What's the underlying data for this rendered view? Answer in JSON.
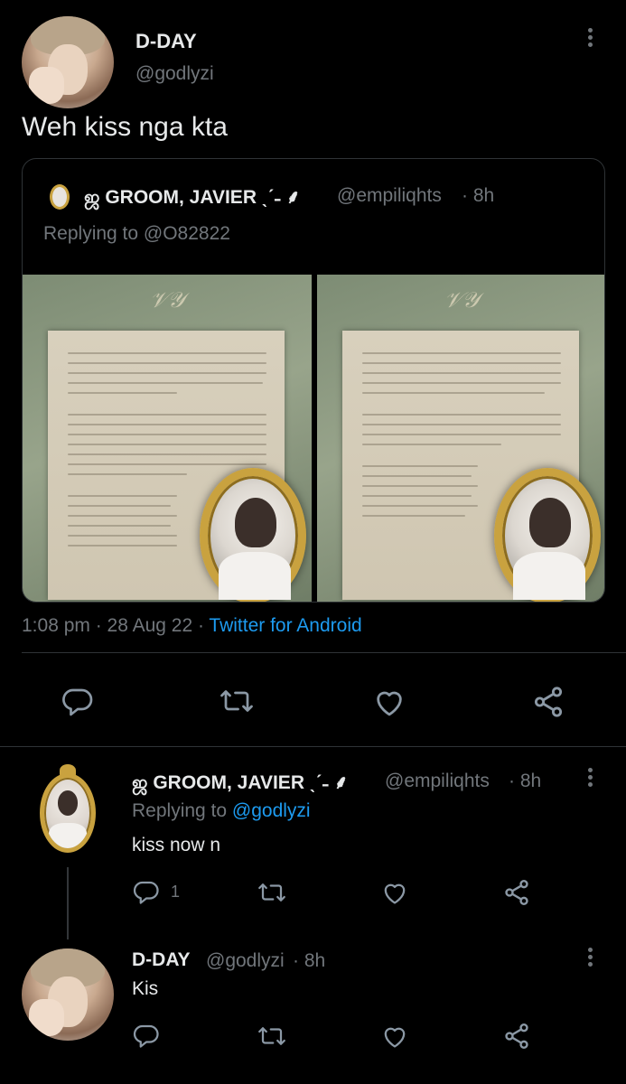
{
  "main_tweet": {
    "display_name": "D-DAY",
    "handle": "@godlyzi",
    "text": "Weh kiss nga kta",
    "timestamp": "1:08 pm · 28 Aug 22 · ",
    "source": "Twitter for Android"
  },
  "quoted_tweet": {
    "display_name": "ஜ GROOM, JAVIER ˎˊ˗ ⸙",
    "handle": "@empiliqhts",
    "age": "· 8h",
    "replying_label": "Replying to ",
    "replying_to": "@O82822"
  },
  "reply_1": {
    "display_name": "ஜ GROOM, JAVIER ˎˊ˗ ⸙",
    "handle": "@empiliqhts",
    "age": "· 8h",
    "replying_label": "Replying to ",
    "replying_to": "@godlyzi",
    "text": "kiss now n",
    "reply_count": "1"
  },
  "reply_2": {
    "display_name": "D-DAY",
    "handle": "@godlyzi",
    "age": "· 8h",
    "text": "Kis"
  },
  "colors": {
    "background": "#000000",
    "text": "#e7e9ea",
    "muted": "#71767b",
    "link": "#1d9bf0",
    "border": "#2f3336"
  },
  "icons": [
    "more-icon",
    "reply-icon",
    "retweet-icon",
    "like-icon",
    "share-icon"
  ]
}
